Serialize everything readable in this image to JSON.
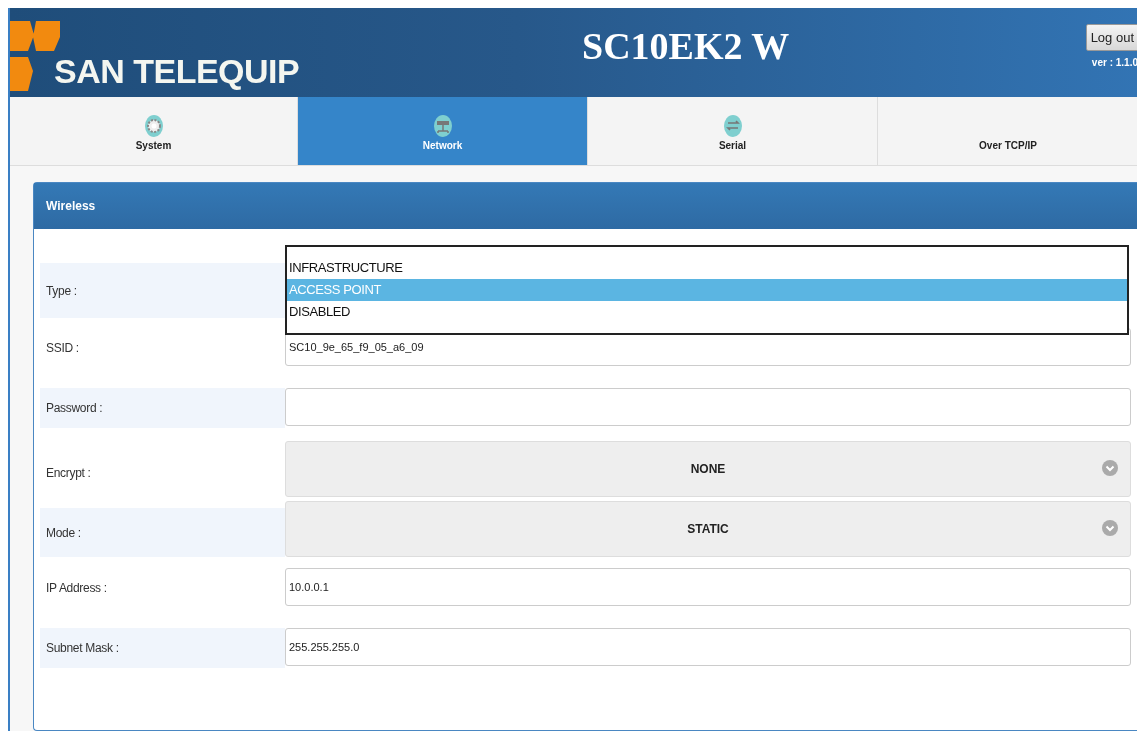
{
  "header": {
    "brand": "SAN TELEQUIP",
    "title": "SC10EK2 W",
    "logout": "Log out",
    "version": "ver : 1.1.0"
  },
  "tabs": [
    {
      "label": "System",
      "kind": "gear",
      "selected": false
    },
    {
      "label": "Network",
      "kind": "network",
      "selected": true
    },
    {
      "label": "Serial",
      "kind": "arrows",
      "selected": false
    },
    {
      "label": "Over TCP/IP",
      "kind": "plain",
      "selected": false
    }
  ],
  "panel": {
    "title": "Wireless",
    "rows": [
      {
        "label": "Type :",
        "kind": "listbox",
        "shaded": true,
        "options": [
          {
            "label": "INFRASTRUCTURE",
            "selected": false
          },
          {
            "label": "ACCESS POINT",
            "selected": true
          },
          {
            "label": "DISABLED",
            "selected": false
          }
        ]
      },
      {
        "label": "SSID :",
        "kind": "text",
        "shaded": false,
        "value": "SC10_9e_65_f9_05_a6_09"
      },
      {
        "label": "Password :",
        "kind": "text",
        "shaded": true
      },
      {
        "label": "Encrypt :",
        "kind": "select",
        "shaded": false,
        "value": "NONE"
      },
      {
        "label": "Mode :",
        "kind": "select",
        "shaded": true,
        "value": "STATIC"
      },
      {
        "label": "IP Address :",
        "kind": "text",
        "shaded": false,
        "value": "10.0.0.1"
      },
      {
        "label": "Subnet Mask :",
        "kind": "text",
        "shaded": true,
        "value": "255.255.255.0"
      }
    ]
  }
}
